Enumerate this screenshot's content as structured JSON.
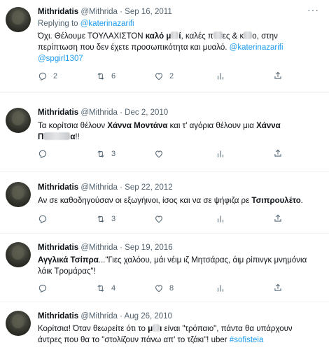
{
  "tweets": [
    {
      "name": "Mithridatis",
      "handle": "@Mithrida",
      "sep": "·",
      "date": "Sep 16, 2011",
      "reply_prefix": "Replying to",
      "reply_to": "@katerinazarifi",
      "text_1": "Όχι. Θέλουμε ΤΟΥΛΑΧΙΣΤΟΝ ",
      "bold_1": "καλό μ",
      "bold_2": "ί",
      "text_2": ", καλές π",
      "text_3": "ες & κ",
      "text_4": "ο, στην περίπτωση που δεν έχετε  προσωπικότητα και μυαλό. ",
      "mention_1": "@katerinazarifi",
      "mention_2": "@spgirl1307",
      "replies": "2",
      "retweets": "6",
      "likes": "2"
    },
    {
      "name": "Mithridatis",
      "handle": "@Mithrida",
      "sep": "·",
      "date": "Dec 2, 2010",
      "text_1": "Τα κορίτσια θέλουν ",
      "bold_1": "Χάννα Μοντάνα",
      "text_2": " και τ' αγόρια θέλουν μια ",
      "bold_2": "Χάννα",
      "bold_3": "Π",
      "bold_4": "α",
      "text_3": "!!",
      "replies": "",
      "retweets": "3",
      "likes": ""
    },
    {
      "name": "Mithridatis",
      "handle": "@Mithrida",
      "sep": "·",
      "date": "Sep 22, 2012",
      "text_1": "Αν σε καθοδηγούσαν οι εξωγήινοι, ίσος και να σε ψήφιζα ρε ",
      "bold_1": "Τσιπρουλέτο",
      "text_2": ".",
      "replies": "",
      "retweets": "3",
      "likes": ""
    },
    {
      "name": "Mithridatis",
      "handle": "@Mithrida",
      "sep": "·",
      "date": "Sep 19, 2016",
      "bold_1": "Αγγλικά Τσίπρα",
      "text_1": "...\"Γιες χαλόου, μάι νέιμ ιζ Μητσάρας, άιμ ρίπινγκ μνημόνια λάικ Τρομάρας\"!",
      "replies": "",
      "retweets": "4",
      "likes": "8"
    },
    {
      "name": "Mithridatis",
      "handle": "@Mithrida",
      "sep": "·",
      "date": "Aug 26, 2010",
      "text_1": "Κορίτσια! Όταν θεωρείτε ότι το ",
      "bold_1": "μ",
      "bold_2": "ι",
      "text_2": " είναι \"τρόπαιο\", πάντα θα υπάρχουν άντρες που θα το \"στολίζουν πάνω απ' το τζάκι\"! uber ",
      "hashtag": "#sofisteia"
    }
  ],
  "icons": {
    "more": "more-horizontal-icon",
    "reply": "reply-icon",
    "retweet": "retweet-icon",
    "like": "heart-icon",
    "views": "views-icon",
    "share": "share-icon"
  },
  "colors": {
    "link": "#1d9bf0",
    "meta": "#536471",
    "text": "#0f1419"
  }
}
